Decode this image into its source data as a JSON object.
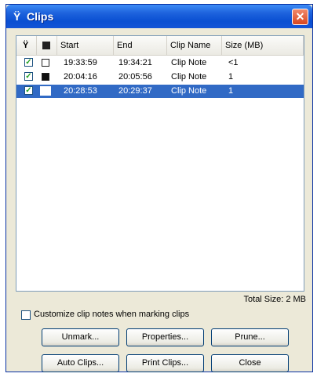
{
  "window": {
    "title": "Clips",
    "title_icon": "antenna-icon",
    "close_glyph": "✕"
  },
  "listview": {
    "columns": [
      {
        "label": "",
        "icon": "antenna-icon"
      },
      {
        "label": "",
        "icon": "film-clip-icon"
      },
      {
        "label": "Start"
      },
      {
        "label": "End"
      },
      {
        "label": "Clip Name"
      },
      {
        "label": "Size (MB)"
      }
    ],
    "rows": [
      {
        "checked": true,
        "start": "19:33:59",
        "end": "19:34:21",
        "name": "Clip Note",
        "size": "<1",
        "selected": false
      },
      {
        "checked": true,
        "start": "20:04:16",
        "end": "20:05:56",
        "name": "Clip Note",
        "size": "1",
        "selected": false
      },
      {
        "checked": true,
        "start": "20:28:53",
        "end": "20:29:37",
        "name": "Clip Note",
        "size": "1",
        "selected": true
      }
    ]
  },
  "status": {
    "total_size": "Total Size: 2 MB"
  },
  "options": {
    "customize_label": "Customize clip notes when marking clips",
    "customize_checked": false
  },
  "buttons": {
    "unmark": "Unmark...",
    "properties": "Properties...",
    "prune": "Prune...",
    "auto_clips": "Auto Clips...",
    "print_clips": "Print Clips...",
    "close": "Close"
  },
  "colors": {
    "titlebar": "#0a4fd2",
    "selection": "#316ac5",
    "close": "#d8461f",
    "window_bg": "#ece9d8"
  }
}
